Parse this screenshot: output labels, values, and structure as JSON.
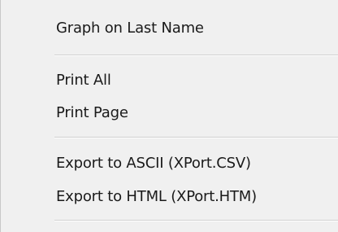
{
  "menu": {
    "items": [
      {
        "label": "Graph on Last Name"
      },
      {
        "label": "Print All"
      },
      {
        "label": "Print Page"
      },
      {
        "label": "Export to ASCII (XPort.CSV)"
      },
      {
        "label": "Export to HTML (XPort.HTM)"
      }
    ]
  }
}
